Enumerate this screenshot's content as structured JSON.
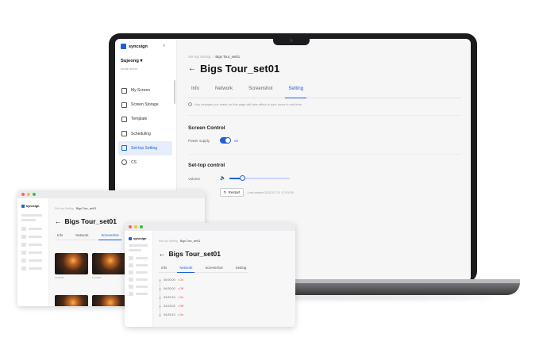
{
  "brand": {
    "name": "syncsign",
    "accent": "#1f5fd6"
  },
  "laptop": {
    "sidebar": {
      "org_name": "Sujeong",
      "org_sub": "mode world",
      "items": [
        {
          "label": "My Screen",
          "icon": "monitor-icon"
        },
        {
          "label": "Screen Storage",
          "icon": "storage-icon"
        },
        {
          "label": "Template",
          "icon": "template-icon"
        },
        {
          "label": "Scheduling",
          "icon": "calendar-icon"
        },
        {
          "label": "Set-top Setting",
          "icon": "settopbox-icon",
          "active": true
        },
        {
          "label": "CS",
          "icon": "headset-icon"
        }
      ]
    },
    "main": {
      "breadcrumb_root": "Set-top Setting",
      "breadcrumb_sep": "/",
      "breadcrumb_current": "Bigs Tour_set01",
      "title": "Bigs Tour_set01",
      "tabs": [
        "Info",
        "Network",
        "Screenshot",
        "Setting"
      ],
      "active_tab": "Setting",
      "notice": "Any changes you make on this page will take effect in your show in real time.",
      "screen_control_heading": "Screen Control",
      "power_label": "Power supply",
      "power_state": "on",
      "settop_heading": "Set-top control",
      "volume_label": "Volume",
      "volume_level": 0.22,
      "restart_label": "Restart",
      "last_restart": "Last restart 2022.07.21 17:01:30"
    }
  },
  "window_screenshot": {
    "breadcrumb_root": "Set-top Setting",
    "breadcrumb_current": "Bigs Tour_set01",
    "title": "Bigs Tour_set01",
    "tabs": [
      "Info",
      "Network",
      "Screenshot"
    ],
    "active_tab": "Screenshot",
    "captions": [
      "12:01:07",
      "12:10:07"
    ]
  },
  "window_network": {
    "breadcrumb_root": "Set-top Setting",
    "breadcrumb_current": "Bigs Tour_set01",
    "title": "Bigs Tour_set01",
    "tabs": [
      "Info",
      "Network",
      "Screenshot",
      "Setting"
    ],
    "active_tab": "Network",
    "events": [
      {
        "time": "00:00:00",
        "state": "On"
      },
      {
        "time": "04:20:02",
        "state": "Off"
      },
      {
        "time": "04:20:10",
        "state": "On"
      },
      {
        "time": "04:23:02",
        "state": "Off"
      },
      {
        "time": "04:25:10",
        "state": "On"
      }
    ]
  }
}
